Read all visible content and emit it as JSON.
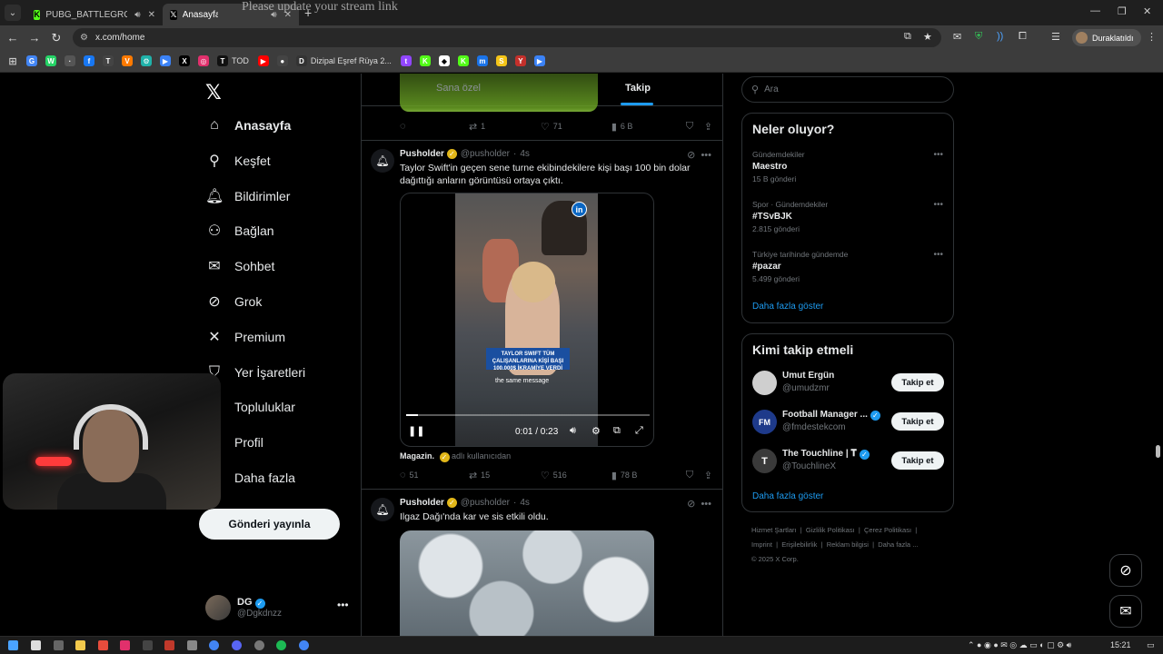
{
  "browser": {
    "tabs": [
      {
        "title": "PUBG_BATTLEGROUNDSTR",
        "favicon_color": "#53fc18",
        "favicon_glyph": "K",
        "active": false
      },
      {
        "title": "Anasayfa / X",
        "favicon_color": "#000000",
        "favicon_glyph": "X",
        "active": true
      }
    ],
    "overlay_text": "Please update your stream link",
    "url": "x.com/home",
    "profile_label": "Duraklatıldı",
    "bookmarks": [
      {
        "icon": "google-icon",
        "color": "#4285f4",
        "glyph": "G",
        "label": ""
      },
      {
        "icon": "whatsapp-icon",
        "color": "#25d366",
        "glyph": "W",
        "label": ""
      },
      {
        "icon": "generic-icon",
        "color": "#555555",
        "glyph": "·",
        "label": ""
      },
      {
        "icon": "facebook-icon",
        "color": "#1877f2",
        "glyph": "f",
        "label": ""
      },
      {
        "icon": "twitch-like-icon",
        "color": "#444444",
        "glyph": "T",
        "label": ""
      },
      {
        "icon": "v-icon",
        "color": "#ff7a00",
        "glyph": "V",
        "label": ""
      },
      {
        "icon": "gear-icon",
        "color": "#20b2aa",
        "glyph": "⚙",
        "label": ""
      },
      {
        "icon": "play-icon",
        "color": "#3b82f6",
        "glyph": "▶",
        "label": ""
      },
      {
        "icon": "x-icon",
        "color": "#000000",
        "glyph": "X",
        "label": ""
      },
      {
        "icon": "instagram-icon",
        "color": "#e1306c",
        "glyph": "◎",
        "label": ""
      },
      {
        "icon": "tod-icon",
        "color": "#111111",
        "glyph": "T",
        "label": "TOD"
      },
      {
        "icon": "youtube-icon",
        "color": "#ff0000",
        "glyph": "▶",
        "label": ""
      },
      {
        "icon": "circle-icon",
        "color": "#444444",
        "glyph": "●",
        "label": ""
      },
      {
        "icon": "dizipal-icon",
        "color": "#333333",
        "glyph": "D",
        "label": "Dizipal Eşref Rüya 2..."
      },
      {
        "icon": "twitch-icon",
        "color": "#9146ff",
        "glyph": "t",
        "label": ""
      },
      {
        "icon": "kick-icon",
        "color": "#53fc18",
        "glyph": "K",
        "label": ""
      },
      {
        "icon": "diamond-icon",
        "color": "#ffffff",
        "glyph": "◆",
        "label": ""
      },
      {
        "icon": "kick-icon",
        "color": "#53fc18",
        "glyph": "K",
        "label": ""
      },
      {
        "icon": "m-icon",
        "color": "#1a73e8",
        "glyph": "m",
        "label": ""
      },
      {
        "icon": "s-icon",
        "color": "#f5c518",
        "glyph": "S",
        "label": ""
      },
      {
        "icon": "ytx-icon",
        "color": "#c4302b",
        "glyph": "Y",
        "label": ""
      },
      {
        "icon": "arrow-icon",
        "color": "#3b82f6",
        "glyph": "▶",
        "label": ""
      }
    ]
  },
  "nav": {
    "items": [
      {
        "label": "Anasayfa",
        "icon": "home-icon",
        "glyph": "⌂",
        "active": true
      },
      {
        "label": "Keşfet",
        "icon": "search-icon",
        "glyph": "⚲",
        "active": false
      },
      {
        "label": "Bildirimler",
        "icon": "bell-icon",
        "glyph": "🔔︎",
        "active": false
      },
      {
        "label": "Bağlan",
        "icon": "add-person-icon",
        "glyph": "⚇",
        "active": false
      },
      {
        "label": "Sohbet",
        "icon": "mail-icon",
        "glyph": "✉",
        "active": false
      },
      {
        "label": "Grok",
        "icon": "grok-icon",
        "glyph": "⊘",
        "active": false
      },
      {
        "label": "Premium",
        "icon": "x-icon",
        "glyph": "✕",
        "active": false
      },
      {
        "label": "Yer İşaretleri",
        "icon": "bookmark-icon",
        "glyph": "⛉",
        "active": false
      },
      {
        "label": "Topluluklar",
        "icon": "people-icon",
        "glyph": "⚉",
        "active": false
      },
      {
        "label": "Profil",
        "icon": "person-icon",
        "glyph": "☺",
        "active": false
      },
      {
        "label": "Daha fazla",
        "icon": "more-icon",
        "glyph": "⋯",
        "active": false
      }
    ],
    "post_button": "Gönderi yayınla",
    "me_name": "DG",
    "me_handle": "@Dgkdnzz"
  },
  "timeline": {
    "tabs": [
      "Sana özel",
      "Takip"
    ],
    "top_actions": {
      "replies": "",
      "reposts": "1",
      "likes": "71",
      "views": "6 B"
    },
    "tweets": [
      {
        "name": "Pusholder",
        "handle": "@pusholder",
        "time": "4s",
        "text": "Taylor Swift'in geçen sene turne ekibindekilere kişi başı 100 bin dolar dağıttığı anların görüntüsü ortaya çıktı.",
        "video_caption": "TAYLOR SWIFT TÜM ÇALIŞANLARINA KİŞİ BAŞI 100.000$ İKRAMİYE VERDİ",
        "video_subtitle": "the same message",
        "video_time": "0:01 / 0:23",
        "video_progress": 0.05,
        "source_name": "Magazin.",
        "source_meta": "adlı kullanıcıdan",
        "replies": "51",
        "reposts": "15",
        "likes": "516",
        "views": "78 B"
      },
      {
        "name": "Pusholder",
        "handle": "@pusholder",
        "time": "4s",
        "text": "Ilgaz Dağı'nda kar ve sis etkili oldu."
      }
    ]
  },
  "sidebar": {
    "search_placeholder": "Ara",
    "trends_title": "Neler oluyor?",
    "trends": [
      {
        "context": "Gündemdekiler",
        "name": "Maestro",
        "count": "15 B gönderi"
      },
      {
        "context": "Spor · Gündemdekiler",
        "name": "#TSvBJK",
        "count": "2.815 gönderi"
      },
      {
        "context": "Türkiye tarihinde gündemde",
        "name": "#pazar",
        "count": "5.499 gönderi"
      }
    ],
    "trends_more": "Daha fazla göster",
    "who_title": "Kimi takip etmeli",
    "who": [
      {
        "name": "Umut Ergün",
        "handle": "@umudzmr",
        "verified": false,
        "avatar_color": "#cccccc"
      },
      {
        "name": "Football Manager ...",
        "handle": "@fmdestekcom",
        "verified": true,
        "avatar_color": "#1e3a8a"
      },
      {
        "name": "The Touchline | 𝐓",
        "handle": "@TouchlineX",
        "verified": true,
        "avatar_color": "#3a3a3a"
      }
    ],
    "follow_label": "Takip et",
    "who_more": "Daha fazla göster",
    "footer": [
      "Hizmet Şartları",
      "Gizlilik Politikası",
      "Çerez Politikası",
      "Imprint",
      "Erişilebilirlik",
      "Reklam bilgisi",
      "Daha fazla ...",
      "© 2025 X Corp."
    ]
  },
  "taskbar": {
    "time": "15:21"
  }
}
